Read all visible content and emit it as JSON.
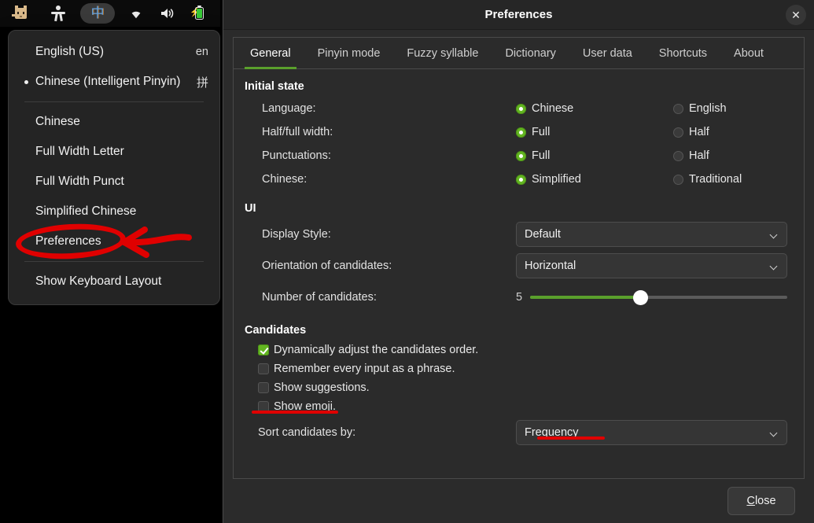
{
  "topbar": {
    "icons": [
      {
        "name": "cat-icon",
        "label": "Cat applet"
      },
      {
        "name": "accessibility-icon",
        "label": "Accessibility"
      },
      {
        "name": "input-method-indicator",
        "label": "中"
      },
      {
        "name": "wifi-icon",
        "label": "Wi-Fi"
      },
      {
        "name": "volume-icon",
        "label": "Volume"
      },
      {
        "name": "battery-icon",
        "label": "Battery charging"
      }
    ],
    "ime_glyph": "中"
  },
  "menu": {
    "engines": [
      {
        "label": "English (US)",
        "badge": "en",
        "selected": false
      },
      {
        "label": "Chinese (Intelligent Pinyin)",
        "badge": "拼",
        "selected": true
      }
    ],
    "items": [
      {
        "label": "Chinese"
      },
      {
        "label": "Full Width Letter"
      },
      {
        "label": "Full Width Punct"
      },
      {
        "label": "Simplified Chinese"
      },
      {
        "label": "Preferences"
      }
    ],
    "footer_item": {
      "label": "Show Keyboard Layout"
    }
  },
  "dialog": {
    "title": "Preferences",
    "close_icon": "✕",
    "tabs": [
      {
        "label": "General",
        "active": true
      },
      {
        "label": "Pinyin mode",
        "active": false
      },
      {
        "label": "Fuzzy syllable",
        "active": false
      },
      {
        "label": "Dictionary",
        "active": false
      },
      {
        "label": "User data",
        "active": false
      },
      {
        "label": "Shortcuts",
        "active": false
      },
      {
        "label": "About",
        "active": false
      }
    ],
    "initial_state": {
      "heading": "Initial state",
      "rows": [
        {
          "label": "Language:",
          "option_a": "Chinese",
          "option_b": "English",
          "selected": "a"
        },
        {
          "label": "Half/full width:",
          "option_a": "Full",
          "option_b": "Half",
          "selected": "a"
        },
        {
          "label": "Punctuations:",
          "option_a": "Full",
          "option_b": "Half",
          "selected": "a"
        },
        {
          "label": "Chinese:",
          "option_a": "Simplified",
          "option_b": "Traditional",
          "selected": "a"
        }
      ]
    },
    "ui_section": {
      "heading": "UI",
      "display_style": {
        "label": "Display Style:",
        "value": "Default"
      },
      "orientation": {
        "label": "Orientation of candidates:",
        "value": "Horizontal"
      },
      "number_of_candidates": {
        "label": "Number of candidates:",
        "value": "5",
        "fill_percent": 43
      }
    },
    "candidates_section": {
      "heading": "Candidates",
      "checkboxes": [
        {
          "label": "Dynamically adjust the candidates order.",
          "checked": true
        },
        {
          "label": "Remember every input as a phrase.",
          "checked": false
        },
        {
          "label": "Show suggestions.",
          "checked": false
        },
        {
          "label": "Show emoji.",
          "checked": false
        }
      ],
      "sort_by": {
        "label": "Sort candidates by:",
        "value": "Frequency"
      }
    },
    "close_button": {
      "mnemonic": "C",
      "rest": "lose"
    }
  },
  "annotations": {
    "color": "#e00000",
    "ellipse_target": "Preferences",
    "underline_targets": [
      "Show emoji.",
      "Frequency"
    ]
  }
}
